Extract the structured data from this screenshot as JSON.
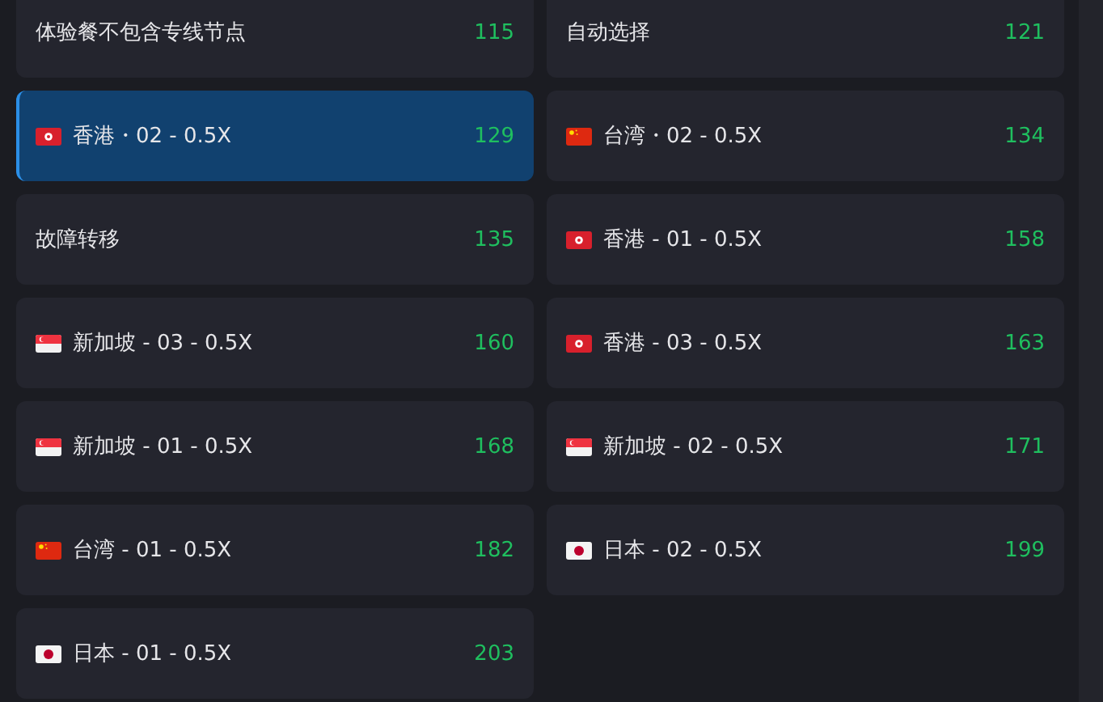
{
  "nodes": [
    {
      "name": "体验餐不包含专线节点",
      "latency": "115",
      "kind": "plain",
      "selected": false
    },
    {
      "name": "自动选择",
      "latency": "121",
      "kind": "plain",
      "selected": false
    },
    {
      "name": "香港・02 - 0.5X",
      "latency": "129",
      "kind": "hk",
      "selected": true
    },
    {
      "name": "台湾・02 - 0.5X",
      "latency": "134",
      "kind": "cn",
      "selected": false
    },
    {
      "name": "故障转移",
      "latency": "135",
      "kind": "plain",
      "selected": false
    },
    {
      "name": "香港 - 01 - 0.5X",
      "latency": "158",
      "kind": "hk",
      "selected": false
    },
    {
      "name": "新加坡 - 03 - 0.5X",
      "latency": "160",
      "kind": "sg",
      "selected": false
    },
    {
      "name": "香港 - 03 - 0.5X",
      "latency": "163",
      "kind": "hk",
      "selected": false
    },
    {
      "name": "新加坡 - 01 - 0.5X",
      "latency": "168",
      "kind": "sg",
      "selected": false
    },
    {
      "name": "新加坡 - 02 - 0.5X",
      "latency": "171",
      "kind": "sg",
      "selected": false
    },
    {
      "name": "台湾 - 01 - 0.5X",
      "latency": "182",
      "kind": "cn",
      "selected": false
    },
    {
      "name": "日本 - 02 - 0.5X",
      "latency": "199",
      "kind": "jp",
      "selected": false
    },
    {
      "name": "日本 - 01 - 0.5X",
      "latency": "203",
      "kind": "jp",
      "selected": false
    }
  ]
}
